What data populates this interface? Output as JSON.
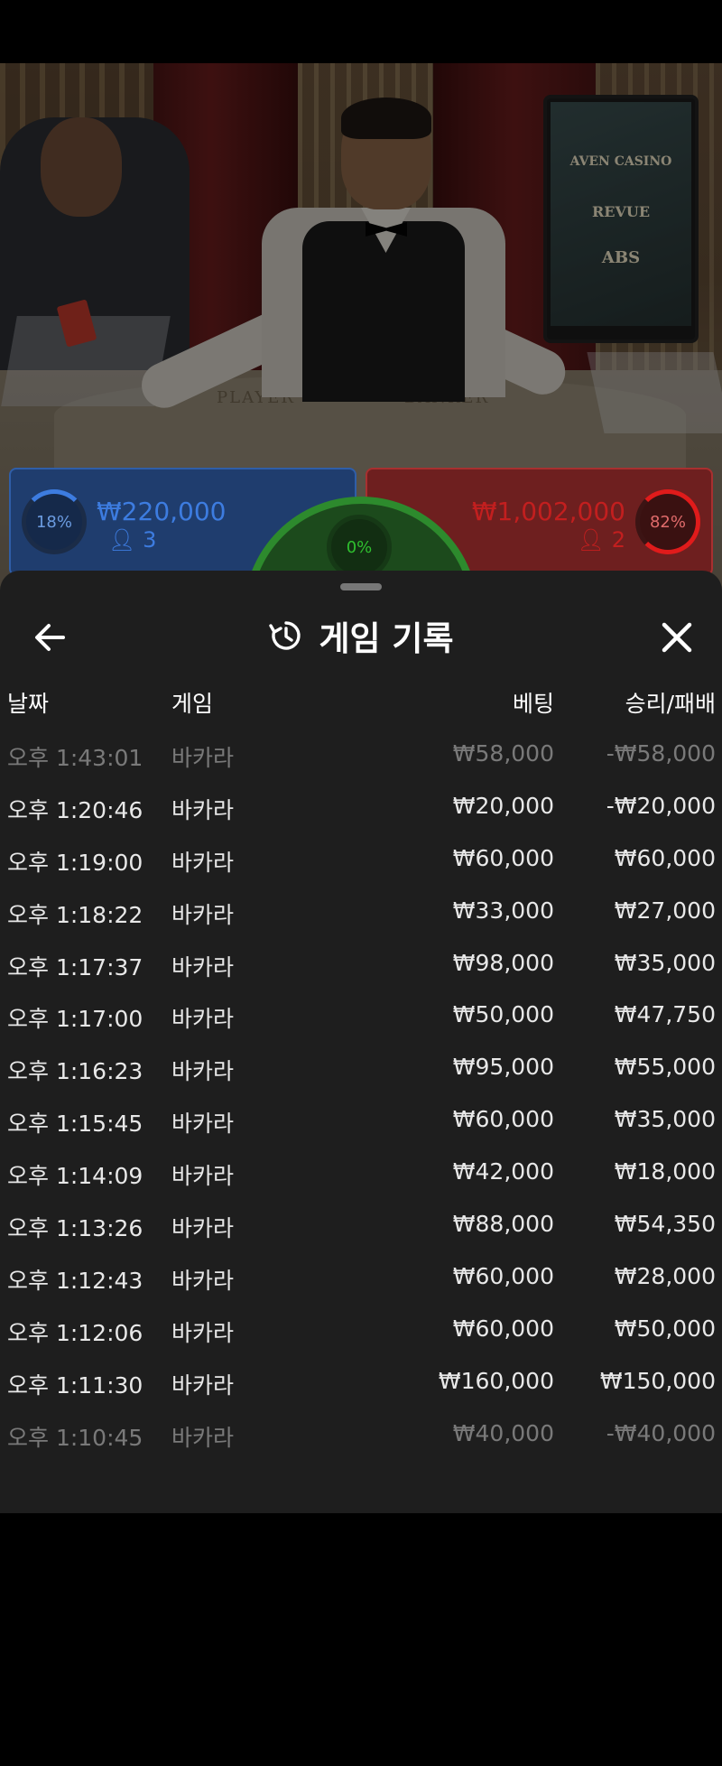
{
  "video": {
    "table_labels": {
      "player": "PLAYER",
      "banker": "BANKER"
    },
    "tablet": {
      "brands": [
        "AVEN CASINO",
        "REVUE",
        "ABS"
      ]
    }
  },
  "bets": {
    "player": {
      "percent": "18%",
      "amount": "₩220,000",
      "players": "3",
      "color": "#3d7ce0"
    },
    "banker": {
      "percent": "82%",
      "amount": "₩1,002,000",
      "players": "2",
      "color": "#c21f1f"
    },
    "tie": {
      "percent": "0%",
      "color": "#2fbf2f"
    }
  },
  "sheet": {
    "title": "게임 기록",
    "back_icon": "arrow-left-icon",
    "history_icon": "history-icon",
    "close_icon": "close-icon"
  },
  "columns": {
    "date": "날짜",
    "game": "게임",
    "bet": "베팅",
    "win_loss": "승리/패배"
  },
  "rows": [
    {
      "date": "오후 1:43:01",
      "game": "바카라",
      "bet": "₩58,000",
      "win": "-₩58,000"
    },
    {
      "date": "오후 1:20:46",
      "game": "바카라",
      "bet": "₩20,000",
      "win": "-₩20,000"
    },
    {
      "date": "오후 1:19:00",
      "game": "바카라",
      "bet": "₩60,000",
      "win": "₩60,000"
    },
    {
      "date": "오후 1:18:22",
      "game": "바카라",
      "bet": "₩33,000",
      "win": "₩27,000"
    },
    {
      "date": "오후 1:17:37",
      "game": "바카라",
      "bet": "₩98,000",
      "win": "₩35,000"
    },
    {
      "date": "오후 1:17:00",
      "game": "바카라",
      "bet": "₩50,000",
      "win": "₩47,750"
    },
    {
      "date": "오후 1:16:23",
      "game": "바카라",
      "bet": "₩95,000",
      "win": "₩55,000"
    },
    {
      "date": "오후 1:15:45",
      "game": "바카라",
      "bet": "₩60,000",
      "win": "₩35,000"
    },
    {
      "date": "오후 1:14:09",
      "game": "바카라",
      "bet": "₩42,000",
      "win": "₩18,000"
    },
    {
      "date": "오후 1:13:26",
      "game": "바카라",
      "bet": "₩88,000",
      "win": "₩54,350"
    },
    {
      "date": "오후 1:12:43",
      "game": "바카라",
      "bet": "₩60,000",
      "win": "₩28,000"
    },
    {
      "date": "오후 1:12:06",
      "game": "바카라",
      "bet": "₩60,000",
      "win": "₩50,000"
    },
    {
      "date": "오후 1:11:30",
      "game": "바카라",
      "bet": "₩160,000",
      "win": "₩150,000"
    },
    {
      "date": "오후 1:10:45",
      "game": "바카라",
      "bet": "₩40,000",
      "win": "-₩40,000"
    }
  ]
}
